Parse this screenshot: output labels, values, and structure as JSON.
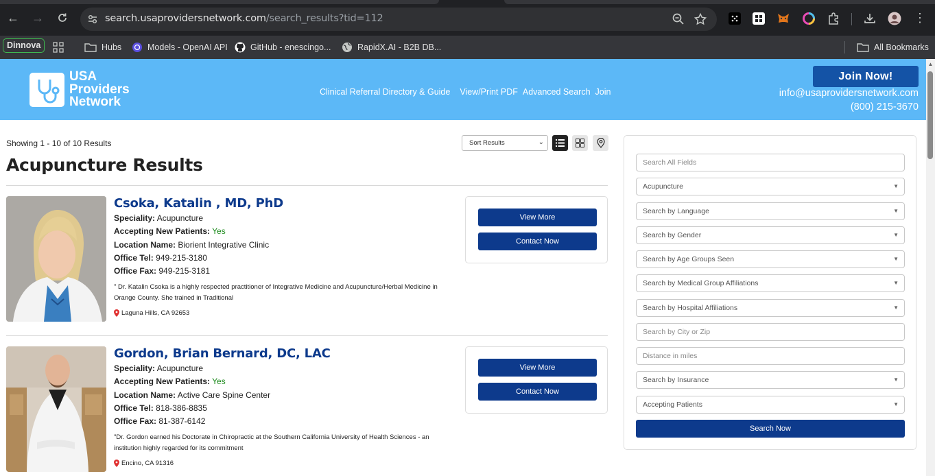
{
  "browser": {
    "url_host": "search.usaprovidersnetwork.com",
    "url_path": "/search_results?tid=112",
    "bookmarks": [
      {
        "label": "Dinnova"
      },
      {
        "label": "Hubs"
      },
      {
        "label": "Models - OpenAI API"
      },
      {
        "label": "GitHub - enescingo..."
      },
      {
        "label": "RapidX.AI - B2B DB..."
      }
    ],
    "all_bookmarks": "All Bookmarks"
  },
  "site": {
    "logo_line1": "USA",
    "logo_line2": "Providers",
    "logo_line3": "Network",
    "nav": [
      "Clinical Referral Directory & Guide",
      "View/Print PDF",
      "Advanced Search",
      "Join"
    ],
    "join_button": "Join Now!",
    "email": "info@usaprovidersnetwork.com",
    "phone": "(800) 215-3670",
    "brand_color": "#5cb8f7",
    "button_color": "#0d3a8c"
  },
  "results": {
    "showing": "Showing 1 - 10 of 10 Results",
    "title": "Acupuncture Results",
    "sort_placeholder": "Sort Results",
    "providers": [
      {
        "name": "Csoka, Katalin , MD, PhD",
        "speciality_label": "Speciality:",
        "speciality": "Acupuncture",
        "accepting_label": "Accepting New Patients:",
        "accepting": "Yes",
        "location_label": "Location Name:",
        "location": "Biorient Integrative Clinic",
        "tel_label": "Office Tel:",
        "tel": "949-215-3180",
        "fax_label": "Office Fax:",
        "fax": "949-215-3181",
        "description": "\" Dr. Katalin Csoka is a highly respected practitioner of Integrative Medicine and Acupuncture/Herbal Medicine in Orange County. She trained in Traditional",
        "city": "Laguna Hills, CA 92653",
        "view_more": "View More",
        "contact_now": "Contact Now"
      },
      {
        "name": "Gordon, Brian Bernard, DC, LAC",
        "speciality_label": "Speciality:",
        "speciality": "Acupuncture",
        "accepting_label": "Accepting New Patients:",
        "accepting": "Yes",
        "location_label": "Location Name:",
        "location": "Active Care Spine Center",
        "tel_label": "Office Tel:",
        "tel": "818-386-8835",
        "fax_label": "Office Fax:",
        "fax": "81-387-6142",
        "description": "\"Dr. Gordon earned his Doctorate in Chiropractic at the Southern California University of Health Sciences - an institution highly regarded for its commitment",
        "city": "Encino, CA 91316",
        "view_more": "View More",
        "contact_now": "Contact Now"
      }
    ]
  },
  "sidebar": {
    "search_all": "Search All Fields",
    "specialty": "Acupuncture",
    "language": "Search by Language",
    "gender": "Search by Gender",
    "age_groups": "Search by Age Groups Seen",
    "medical_group": "Search by Medical Group Affiliations",
    "hospital": "Search by Hospital Affiliations",
    "city_zip": "Search by City or Zip",
    "distance": "Distance in miles",
    "insurance": "Search by Insurance",
    "accepting": "Accepting Patients",
    "search_button": "Search Now"
  }
}
